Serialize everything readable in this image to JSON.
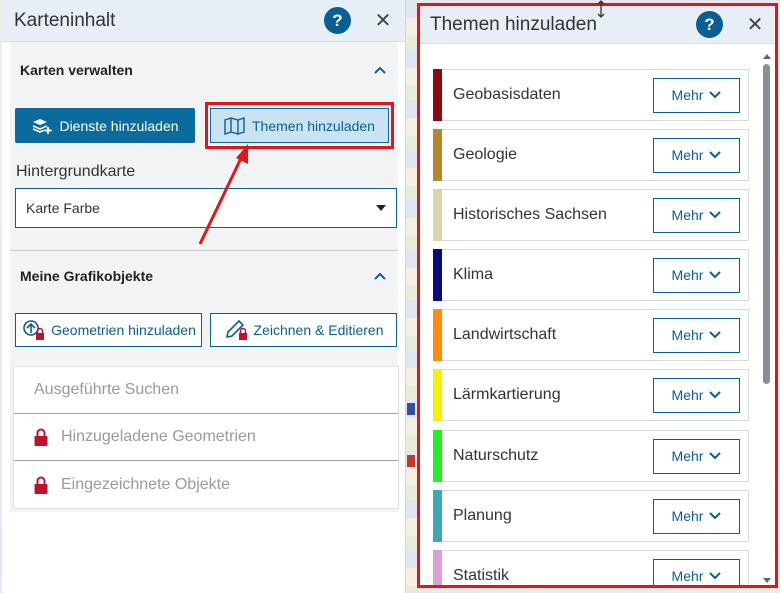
{
  "left_panel": {
    "title": "Karteninhalt",
    "help_label": "?",
    "close_label": "✕",
    "section_manage": {
      "title": "Karten verwalten",
      "dienste_button": "Dienste hinzuladen",
      "themen_button": "Themen hinzuladen",
      "background_label": "Hintergrundkarte",
      "background_value": "Karte Farbe"
    },
    "section_graphics": {
      "title": "Meine Grafikobjekte",
      "geometries_button": "Geometrien hinzuladen",
      "draw_button": "Zeichnen & Editieren",
      "list": [
        {
          "label": "Ausgeführte Suchen",
          "locked": false
        },
        {
          "label": "Hinzugeladene Geometrien",
          "locked": true
        },
        {
          "label": "Eingezeichnete Objekte",
          "locked": true
        }
      ]
    }
  },
  "right_panel": {
    "title": "Themen hinzuladen",
    "help_label": "?",
    "close_label": "✕",
    "more_label": "Mehr",
    "topics": [
      {
        "label": "Geobasisdaten",
        "color": "#8b0b14"
      },
      {
        "label": "Geologie",
        "color": "#b5872b"
      },
      {
        "label": "Historisches Sachsen",
        "color": "#ddd4ac"
      },
      {
        "label": "Klima",
        "color": "#0a0a80"
      },
      {
        "label": "Landwirtschaft",
        "color": "#ff8c0a"
      },
      {
        "label": "Lärmkartierung",
        "color": "#f5ef0a"
      },
      {
        "label": "Naturschutz",
        "color": "#22ee22"
      },
      {
        "label": "Planung",
        "color": "#3fa7b4"
      },
      {
        "label": "Statistik",
        "color": "#dca0d8"
      }
    ]
  },
  "colors": {
    "accent": "#0b5e94",
    "highlight": "#e0161b"
  }
}
